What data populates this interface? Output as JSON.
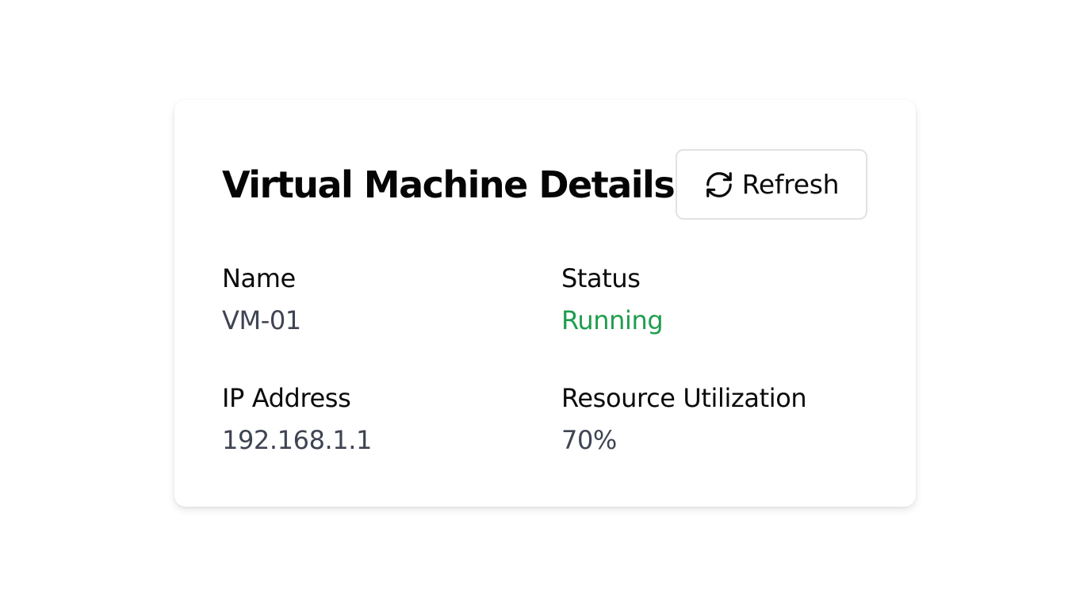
{
  "card": {
    "title": "Virtual Machine Details",
    "refresh_button": {
      "label": "Refresh",
      "icon": "refresh-icon"
    }
  },
  "details": {
    "name": {
      "label": "Name",
      "value": "VM-01"
    },
    "status": {
      "label": "Status",
      "value": "Running",
      "color": "#1f9d4f"
    },
    "ip": {
      "label": "IP Address",
      "value": "192.168.1.1"
    },
    "resource": {
      "label": "Resource Utilization",
      "value": "70%"
    }
  }
}
